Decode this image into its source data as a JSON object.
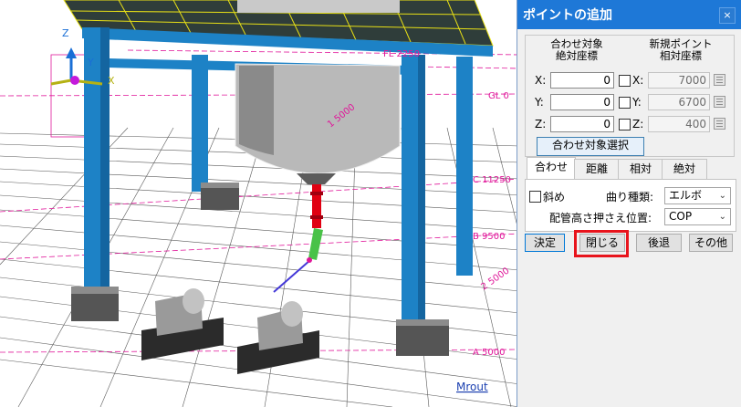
{
  "viewport": {
    "axis_z_label": "Z",
    "axis_y_label": "Y",
    "axis_x_label": "X",
    "grid_labels": [
      "GL 0",
      "C 11250",
      "B 9500",
      "A 5000",
      "FL 2250",
      "1 5000",
      "2 5000"
    ],
    "model_name": "Mrout"
  },
  "dialog": {
    "title": "ポイントの追加",
    "close_glyph": "×",
    "absolute_header_line1": "合わせ対象",
    "absolute_header_line2": "絶対座標",
    "relative_header_line1": "新規ポイント",
    "relative_header_line2": "相対座標",
    "rows": [
      {
        "axis": "X:",
        "abs_value": "0",
        "rel_axis": "X:",
        "rel_value": "7000"
      },
      {
        "axis": "Y:",
        "abs_value": "0",
        "rel_axis": "Y:",
        "rel_value": "6700"
      },
      {
        "axis": "Z:",
        "abs_value": "0",
        "rel_axis": "Z:",
        "rel_value": "400"
      }
    ],
    "target_select_button": "合わせ対象選択",
    "tabs": [
      "合わせ",
      "距離",
      "相対",
      "絶対"
    ],
    "active_tab": "合わせ",
    "oblique_label": "斜め",
    "bend_type_label": "曲り種類:",
    "bend_type_value": "エルボ",
    "pipe_height_label": "配管高さ押さえ位置:",
    "pipe_height_value": "COP",
    "buttons": {
      "ok": "決定",
      "close": "閉じる",
      "back": "後退",
      "other": "その他"
    }
  },
  "colors": {
    "title_bar": "#1e78d7",
    "structure": "#1d82c6",
    "grid_label": "#e0179a",
    "highlight": "#e8141c"
  }
}
